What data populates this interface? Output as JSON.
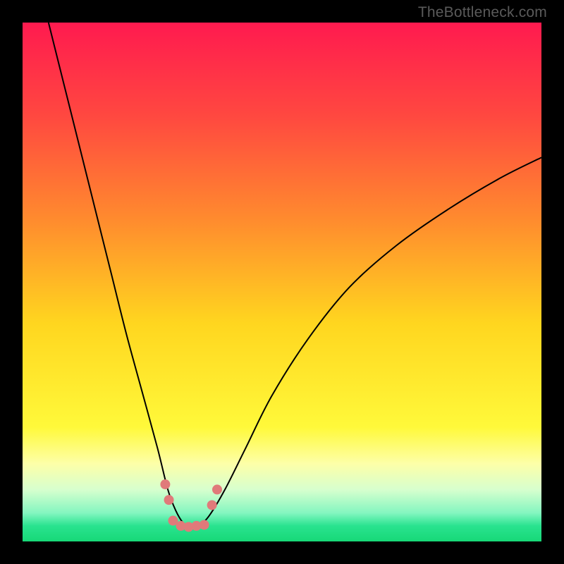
{
  "watermark": {
    "text": "TheBottleneck.com"
  },
  "chart_data": {
    "type": "line",
    "title": "",
    "xlabel": "",
    "ylabel": "",
    "xlim": [
      0,
      100
    ],
    "ylim": [
      0,
      100
    ],
    "background_gradient": {
      "stops": [
        {
          "pos": 0.0,
          "color": "#ff1a4f"
        },
        {
          "pos": 0.18,
          "color": "#ff4840"
        },
        {
          "pos": 0.38,
          "color": "#ff8b2e"
        },
        {
          "pos": 0.58,
          "color": "#ffd61f"
        },
        {
          "pos": 0.78,
          "color": "#fff93a"
        },
        {
          "pos": 0.85,
          "color": "#fdffa8"
        },
        {
          "pos": 0.9,
          "color": "#d7ffce"
        },
        {
          "pos": 0.945,
          "color": "#84f6c0"
        },
        {
          "pos": 0.97,
          "color": "#29e38f"
        },
        {
          "pos": 1.0,
          "color": "#17d877"
        }
      ]
    },
    "series": [
      {
        "name": "bottleneck-curve",
        "color": "#000000",
        "stroke_width": 2,
        "x": [
          5,
          8,
          11,
          14,
          17,
          20,
          23,
          26,
          28,
          29.5,
          31,
          32.5,
          34,
          36,
          39,
          43,
          48,
          55,
          63,
          72,
          82,
          92,
          100
        ],
        "y": [
          100,
          88,
          76,
          64,
          52,
          40,
          29,
          18,
          10,
          6,
          3.5,
          2.5,
          3,
          5,
          10,
          18,
          28,
          39,
          49,
          57,
          64,
          70,
          74
        ]
      }
    ],
    "scatter": {
      "name": "bottleneck-points",
      "color": "#e07a7a",
      "radius": 7,
      "points": [
        {
          "x": 27.5,
          "y": 11
        },
        {
          "x": 28.2,
          "y": 8
        },
        {
          "x": 29.0,
          "y": 4.0
        },
        {
          "x": 30.5,
          "y": 3.0
        },
        {
          "x": 32.0,
          "y": 2.8
        },
        {
          "x": 33.5,
          "y": 3.0
        },
        {
          "x": 35.0,
          "y": 3.2
        },
        {
          "x": 36.5,
          "y": 7
        },
        {
          "x": 37.5,
          "y": 10
        }
      ]
    }
  }
}
